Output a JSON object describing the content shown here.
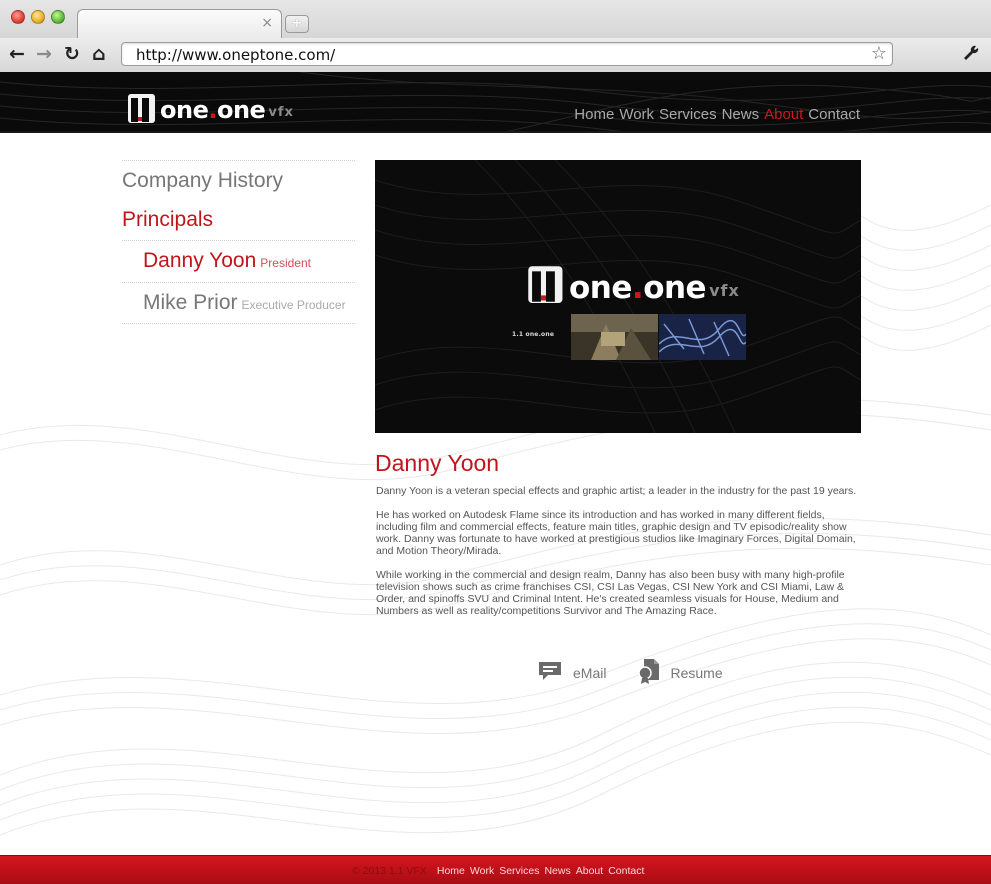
{
  "browser": {
    "url": "http://www.oneptone.com/",
    "tab_close": "×",
    "new_tab": "+",
    "back": "←",
    "forward": "→",
    "reload": "↻",
    "home": "⌂",
    "star": "☆",
    "wrench": "🔧"
  },
  "header": {
    "logo_word_a": "one",
    "logo_dot": ".",
    "logo_word_b": "one",
    "logo_vfx": "vfx",
    "nav": [
      {
        "label": "Home"
      },
      {
        "label": "Work"
      },
      {
        "label": "Services"
      },
      {
        "label": "News"
      },
      {
        "label": "About"
      },
      {
        "label": "Contact"
      }
    ],
    "active_color": "#d0151d"
  },
  "sidenav": {
    "company_history": "Company History",
    "principals": "Principals",
    "people": [
      {
        "name": "Danny Yoon",
        "role": "President"
      },
      {
        "name": "Mike Prior",
        "role": "Executive Producer"
      }
    ]
  },
  "hero": {
    "logo_word_a": "one",
    "logo_dot": ".",
    "logo_word_b": "one",
    "logo_vfx": "vfx",
    "small_logo": "1.1 one.one"
  },
  "profile": {
    "name": "Danny Yoon",
    "bio": [
      "Danny Yoon is a veteran special effects and graphic artist; a leader in the industry for the past 19 years.",
      "He has worked on Autodesk Flame since its introduction and has worked in many different fields, including film and commercial effects, feature main titles, graphic design and TV episodic/reality show work. Danny was fortunate to have worked at prestigious studios like Imaginary Forces, Digital Domain, and Motion Theory/Mirada.",
      "While working in the commercial and design realm, Danny has also been busy with many high-profile television shows such as crime franchises CSI, CSI Las Vegas, CSI New York and CSI Miami, Law & Order, and spinoffs SVU and Criminal Intent. He's created seamless visuals for House, Medium and Numbers as well as reality/competitions Survivor and The Amazing Race."
    ],
    "email_label": "eMail",
    "resume_label": "Resume"
  },
  "footer": {
    "copyright": "© 2013 1.1 VFX",
    "links": [
      "Home",
      "Work",
      "Services",
      "News",
      "About",
      "Contact"
    ]
  },
  "colors": {
    "brand_red": "#c2141b",
    "header_bg": "#0a0a0a",
    "footer_red": "#d5151e"
  }
}
